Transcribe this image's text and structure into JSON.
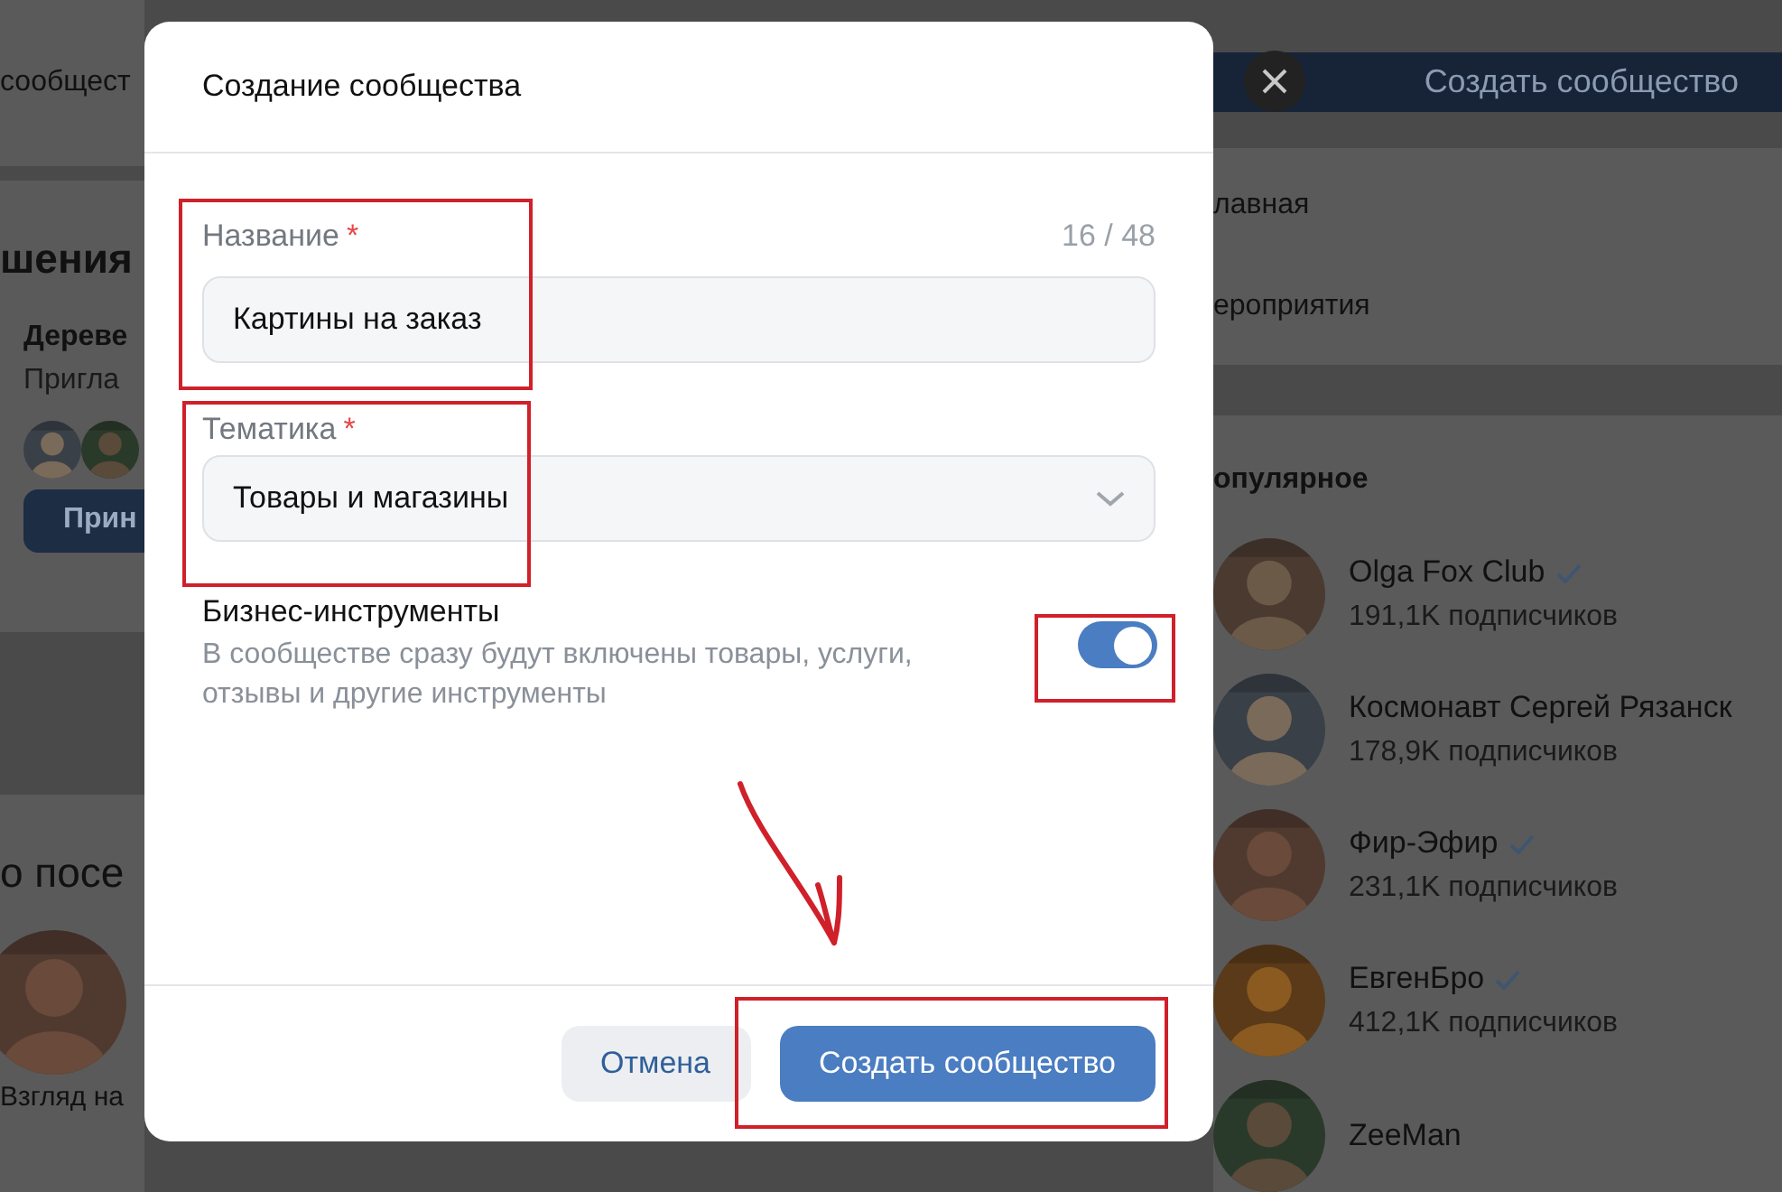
{
  "background_page": {
    "left": {
      "search_text": "сообщест",
      "section_title": "шения",
      "invite": {
        "name": "Дереве",
        "subtitle": "Пригла",
        "button": "Прин"
      },
      "section_title_2": "о посе",
      "recent_item": "Взгляд на"
    },
    "right": {
      "create_button": "Создать сообщество",
      "menu": [
        "лавная",
        "ероприятия"
      ],
      "popular_title": "опулярное",
      "communities": [
        {
          "name": "Olga Fox Club",
          "verified": true,
          "subscribers": "191,1K подписчиков"
        },
        {
          "name": "Космонавт Сергей Рязанск",
          "verified": false,
          "subscribers": "178,9K подписчиков"
        },
        {
          "name": "Фир-Эфир",
          "verified": true,
          "subscribers": "231,1K подписчиков"
        },
        {
          "name": "ЕвгенБро",
          "verified": true,
          "subscribers": "412,1K подписчиков"
        },
        {
          "name": "ZeeMan",
          "verified": false
        }
      ]
    }
  },
  "dialog": {
    "title": "Создание сообщества",
    "name_field": {
      "label": "Название",
      "required_mark": "*",
      "counter": "16 / 48",
      "value": "Картины на заказ"
    },
    "topic_field": {
      "label": "Тематика",
      "required_mark": "*",
      "value": "Товары и магазины"
    },
    "business_tools": {
      "title": "Бизнес-инструменты",
      "description": "В сообществе сразу будут включены товары, услуги, отзывы и другие инструменты",
      "on": true
    },
    "buttons": [
      {
        "label": "Отмена",
        "kind": "secondary"
      },
      {
        "label": "Создать сообщество",
        "kind": "primary"
      }
    ]
  }
}
